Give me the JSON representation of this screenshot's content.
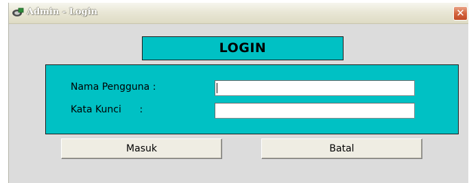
{
  "window": {
    "title": "Admin - Login",
    "close_glyph": "✕",
    "icon": "app-window-icon"
  },
  "header": {
    "title": "LOGIN"
  },
  "form": {
    "username_label": "Nama Pengguna :",
    "username_value": "",
    "password_label": "Kata Kunci      :",
    "password_value": ""
  },
  "buttons": {
    "login_label": "Masuk",
    "cancel_label": "Batal"
  },
  "colors": {
    "panel": "#00c1c4",
    "window_bg": "#dcdcdc",
    "close_button": "#d4653f"
  }
}
